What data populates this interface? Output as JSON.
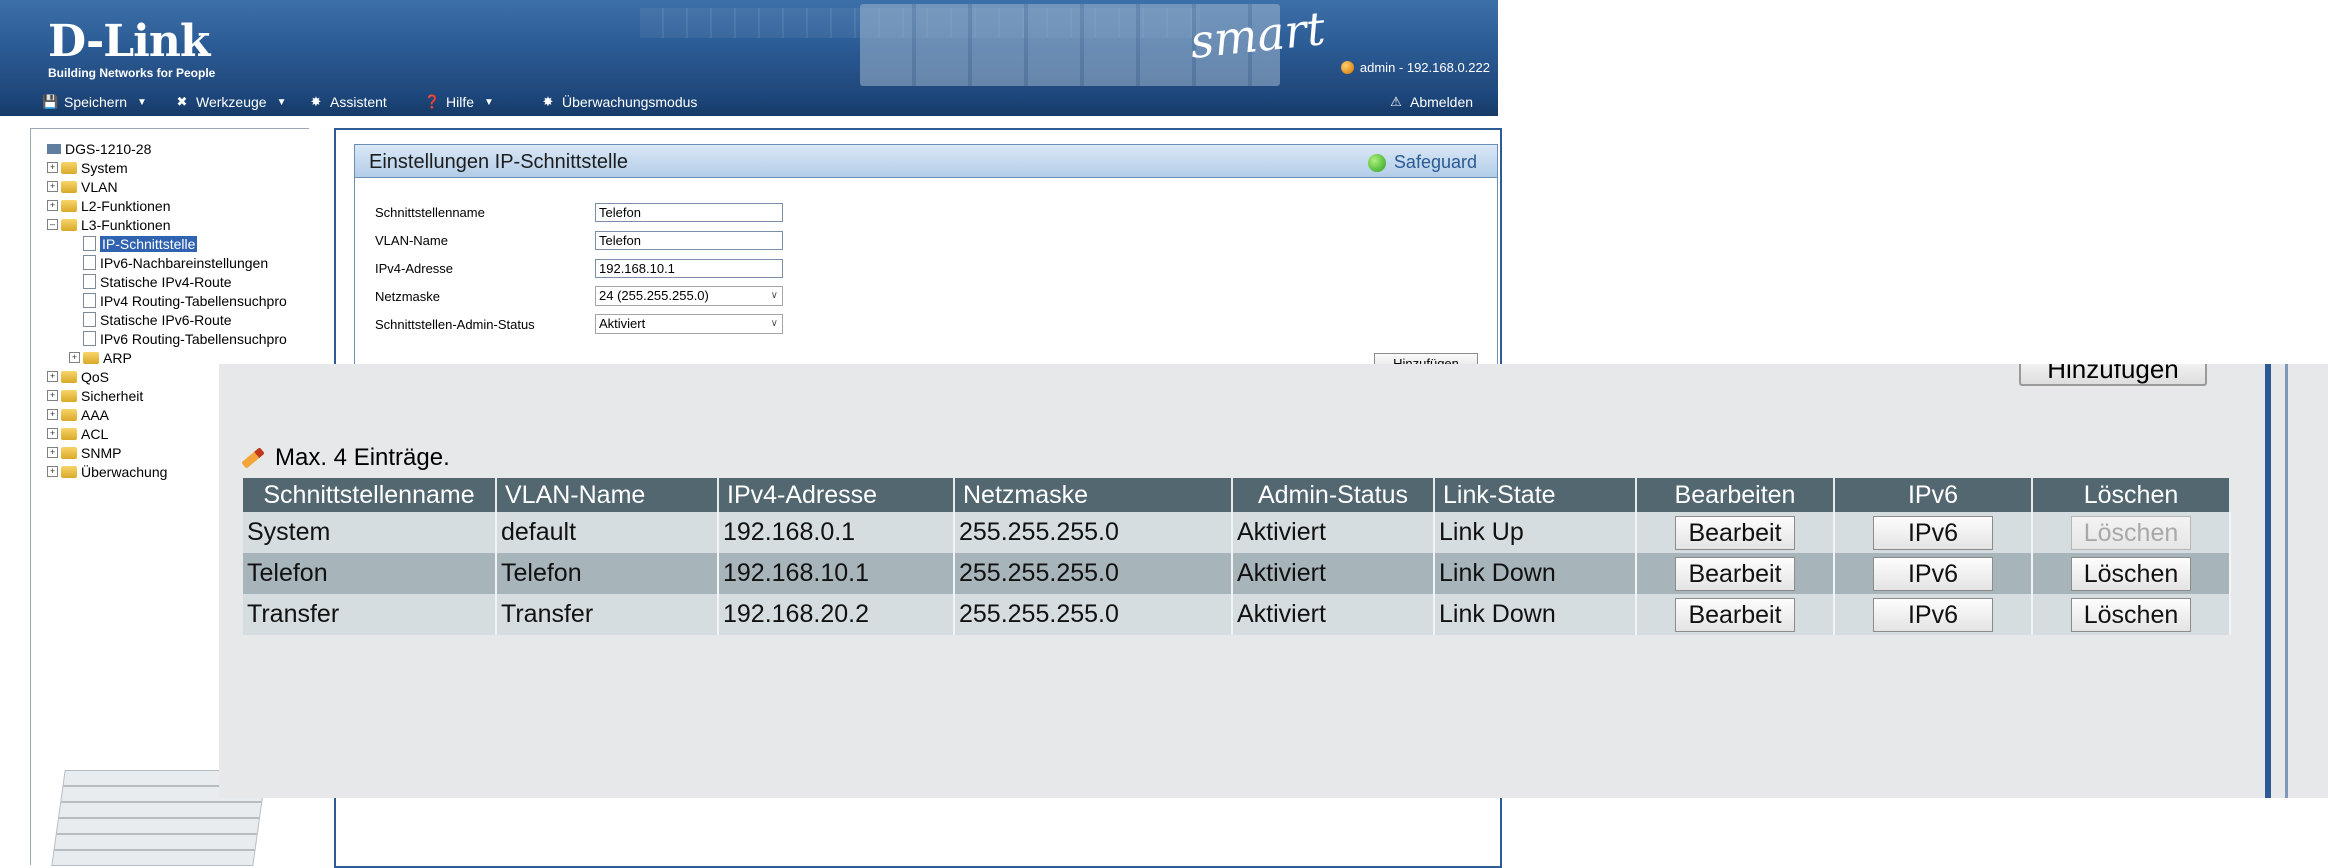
{
  "header": {
    "brand": "D-Link",
    "tagline": "Building Networks for People",
    "smart_logo": "smart",
    "user_info": "admin - 192.168.0.222",
    "user_icon": "user-bulb-icon"
  },
  "menu": {
    "save": "Speichern",
    "tools": "Werkzeuge",
    "wizard": "Assistent",
    "help": "Hilfe",
    "surveillance": "Überwachungsmodus",
    "logout": "Abmelden"
  },
  "tree": {
    "root": "DGS-1210-28",
    "items": [
      {
        "label": "System"
      },
      {
        "label": "VLAN"
      },
      {
        "label": "L2-Funktionen"
      },
      {
        "label": "L3-Funktionen"
      },
      {
        "label": "IP-Schnittstelle"
      },
      {
        "label": "IPv6-Nachbareinstellungen"
      },
      {
        "label": "Statische IPv4-Route"
      },
      {
        "label": "IPv4 Routing-Tabellensuchpro"
      },
      {
        "label": "Statische IPv6-Route"
      },
      {
        "label": "IPv6 Routing-Tabellensuchpro"
      },
      {
        "label": "ARP"
      },
      {
        "label": "QoS"
      },
      {
        "label": "Sicherheit"
      },
      {
        "label": "AAA"
      },
      {
        "label": "ACL"
      },
      {
        "label": "SNMP"
      },
      {
        "label": "Überwachung"
      }
    ]
  },
  "panel": {
    "title": "Einstellungen IP-Schnittstelle",
    "safeguard": "Safeguard",
    "fields": {
      "ifname_label": "Schnittstellenname",
      "ifname_value": "Telefon",
      "vlan_label": "VLAN-Name",
      "vlan_value": "Telefon",
      "ipv4_label": "IPv4-Adresse",
      "ipv4_value": "192.168.10.1",
      "mask_label": "Netzmaske",
      "mask_value": "24 (255.255.255.0)",
      "status_label": "Schnittstellen-Admin-Status",
      "status_value": "Aktiviert"
    },
    "add_button": "Hinzufügen"
  },
  "overlay": {
    "add_button": "Hinzufügen",
    "max_entries": "Max. 4 Einträge.",
    "table": {
      "headers": [
        "Schnittstellenname",
        "VLAN-Name",
        "IPv4-Adresse",
        "Netzmaske",
        "Admin-Status",
        "Link-State",
        "Bearbeiten",
        "IPv6",
        "Löschen"
      ],
      "rows": [
        {
          "name": "System",
          "vlan": "default",
          "ip": "192.168.0.1",
          "mask": "255.255.255.0",
          "admin": "Aktiviert",
          "link": "Link Up",
          "edit": "Bearbeit",
          "ipv6": "IPv6",
          "del": "Löschen"
        },
        {
          "name": "Telefon",
          "vlan": "Telefon",
          "ip": "192.168.10.1",
          "mask": "255.255.255.0",
          "admin": "Aktiviert",
          "link": "Link Down",
          "edit": "Bearbeit",
          "ipv6": "IPv6",
          "del": "Löschen"
        },
        {
          "name": "Transfer",
          "vlan": "Transfer",
          "ip": "192.168.20.2",
          "mask": "255.255.255.0",
          "admin": "Aktiviert",
          "link": "Link Down",
          "edit": "Bearbeit",
          "ipv6": "IPv6",
          "del": "Löschen"
        }
      ]
    }
  },
  "colors": {
    "header_blue": "#2a5a93",
    "table_header": "#536770",
    "row_light": "#d6dde0",
    "row_dark": "#a7b5ba",
    "selected_item": "#2f62b0"
  }
}
